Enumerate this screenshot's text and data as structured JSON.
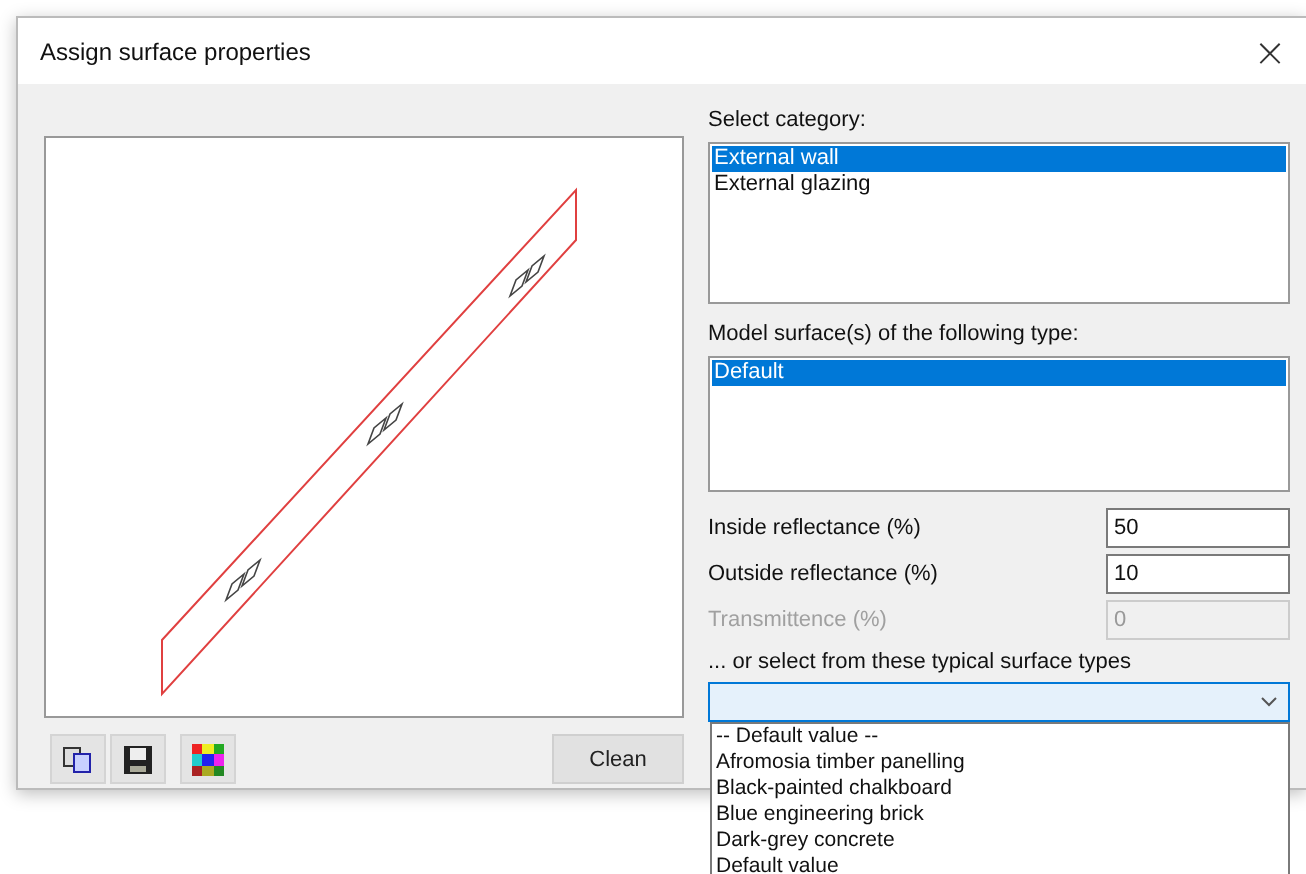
{
  "window": {
    "title": "Assign surface properties",
    "close": "×"
  },
  "category": {
    "label": "Select category:",
    "items": [
      {
        "label": "External wall",
        "selected": true
      },
      {
        "label": "External glazing",
        "selected": false
      }
    ]
  },
  "surface_type": {
    "label": "Model surface(s) of the following type:",
    "items": [
      {
        "label": "Default",
        "selected": true
      }
    ]
  },
  "fields": [
    {
      "label": "Inside reflectance (%)",
      "value": "50",
      "disabled": false
    },
    {
      "label": "Outside reflectance (%)",
      "value": "10",
      "disabled": false
    },
    {
      "label": "Transmittence (%)",
      "value": "0",
      "disabled": true
    }
  ],
  "typical": {
    "label": "... or select from these typical surface types",
    "expanded": true,
    "options": [
      {
        "label": "-- Default value --",
        "selected": false
      },
      {
        "label": "Afromosia timber panelling",
        "selected": false
      },
      {
        "label": "Black-painted chalkboard",
        "selected": false
      },
      {
        "label": "Blue engineering brick",
        "selected": false
      },
      {
        "label": "Dark-grey concrete",
        "selected": false
      },
      {
        "label": "Default value",
        "selected": false
      }
    ]
  },
  "toolbar": [
    {
      "kind": "copy"
    },
    {
      "kind": "save"
    },
    {
      "kind": "colors"
    }
  ],
  "clean_button": "Clean"
}
